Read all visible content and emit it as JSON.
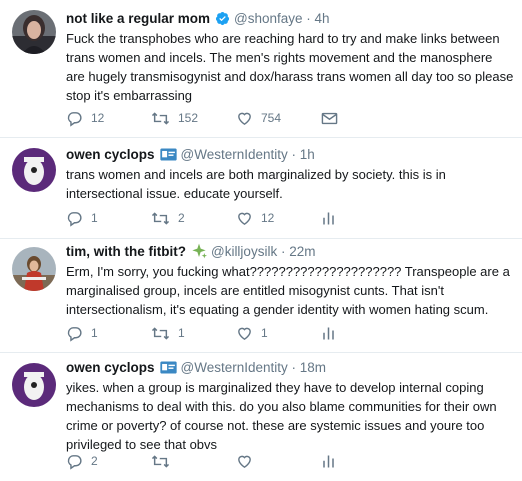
{
  "colors": {
    "text": "#14171a",
    "muted": "#657786",
    "verified_blue": "#1da1f2",
    "divider": "#e6ecf0"
  },
  "tweets": [
    {
      "name": "not like a regular mom",
      "badge_icon": "verified-badge-icon",
      "handle": "@shonfaye",
      "time": "4h",
      "text": "Fuck the transphobes who are reaching hard to try and make links between trans women and incels. The men's rights movement and the manosphere are hugely transmisogynist and dox/harass trans women all day too so please stop it's embarrassing",
      "replies": "12",
      "retweets": "152",
      "likes": "754",
      "fourth_icon": "direct-message-icon"
    },
    {
      "name": "owen cyclops",
      "badge_icon": "id-card-emoji-icon",
      "handle": "@WesternIdentity",
      "time": "1h",
      "text": "trans women and incels are both marginalized by society. this is in intersectional issue. educate yourself.",
      "replies": "1",
      "retweets": "2",
      "likes": "12",
      "fourth_icon": "analytics-icon"
    },
    {
      "name": "tim, with the fitbit?",
      "badge_icon": "sparkle-emoji-icon",
      "handle": "@killjoysilk",
      "time": "22m",
      "text": "Erm, I'm sorry, you fucking what????????????????????? Transpeople are a marginalised group, incels are entitled misogynist cunts. That isn't intersectionalism, it's equating a gender identity with women hating scum.",
      "replies": "1",
      "retweets": "1",
      "likes": "1",
      "fourth_icon": "analytics-icon"
    },
    {
      "name": "owen cyclops",
      "badge_icon": "id-card-emoji-icon",
      "handle": "@WesternIdentity",
      "time": "18m",
      "text": "yikes. when a group is marginalized they have to develop internal coping mechanisms to deal with this. do you also blame communities for their own crime or poverty? of course not. these are systemic issues and youre too privileged to see that obvs",
      "replies": "2",
      "retweets": "",
      "likes": "",
      "fourth_icon": "analytics-icon"
    }
  ]
}
